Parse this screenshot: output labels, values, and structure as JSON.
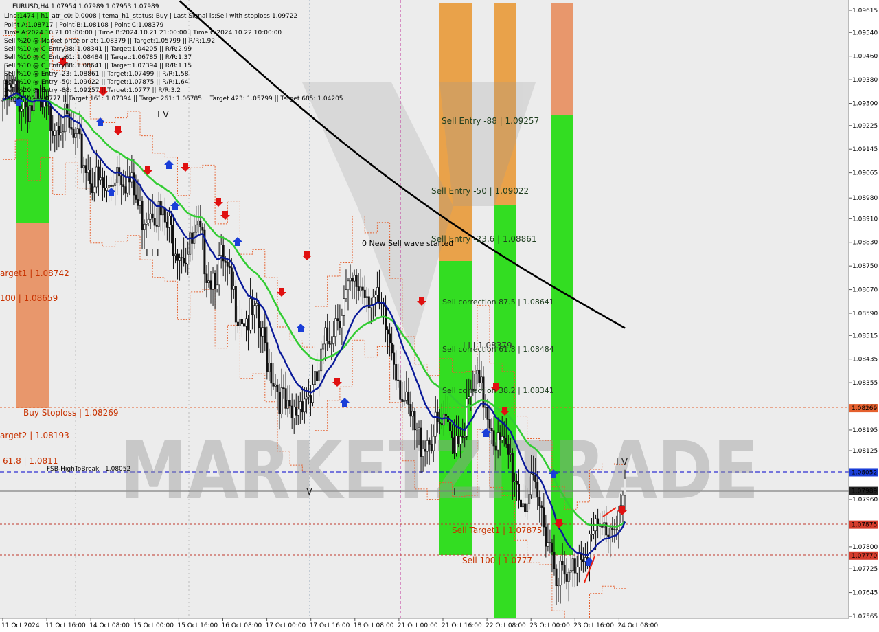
{
  "symbol_line": "EURUSD,H4  1.07954 1.07989 1.07953 1.07989",
  "info_lines": [
    "Line:1474  | h1_atr_c0: 0.0008  | tema_h1_status: Buy  | Last Signal is:Sell with stoploss:1.09722",
    "Point A:1.08717 | Point B:1.08108 | Point C:1.08379",
    "Time A:2024.10.21 01:00:00 | Time B:2024.10.21 21:00:00 | Time C:2024.10.22 10:00:00",
    "Sell %20 @ Market price or at: 1.08379  ||  Target:1.05799  ||  R/R:1.92",
    "Sell %10 @ C_Entry38: 1.08341  ||  Target:1.04205  ||  R/R:2.99",
    "Sell %10 @ C_Entry61: 1.08484  ||  Target:1.06785  ||  R/R:1.37",
    "Sell %10 @ C_Entry88: 1.08641  ||  Target:1.07394  ||  R/R:1.15",
    "Sell %10 @ Entry -23: 1.08861  ||  Target:1.07499  ||  R/R:1.58",
    "Sell %10 @ Entry -50: 1.09022  ||  Target:1.07875  ||  R/R:1.64",
    "Sell %20 @ Entry -88: 1.09257  ||  Target:1.0777  ||  R/R:3.2",
    "Target100: 1.0777  ||  Target 161: 1.07394  ||  Target 261: 1.06785  ||  Target 423: 1.05799  ||  Target 685: 1.04205"
  ],
  "watermark": "MARKETZITRADE",
  "zone_labels": [
    {
      "text": "Sell Entry -88 | 1.09257",
      "price": 1.09257,
      "color": "#1e3d1e"
    },
    {
      "text": "Sell Entry -50 | 1.09022",
      "price": 1.09022,
      "color": "#1e3d1e"
    },
    {
      "text": "Sell Entry -23.6 | 1.08861",
      "price": 1.08861,
      "color": "#1e3d1e"
    },
    {
      "text": "0 New Sell wave started",
      "price": 1.0883,
      "color": "#000000"
    },
    {
      "text": "Sell correction 87.5 | 1.08641",
      "price": 1.08641,
      "color": "#1e3d1e"
    },
    {
      "text": "Sell correction 61.8 | 1.08484",
      "price": 1.08484,
      "color": "#1e3d1e"
    },
    {
      "text": "Sell correction 38.2 | 1.08341",
      "price": 1.08341,
      "color": "#1e3d1e"
    },
    {
      "text": "Sell Target1 | 1.07875",
      "price": 1.07875,
      "color": "#c83200"
    },
    {
      "text": "Sell 100 | 1.0777",
      "price": 1.0777,
      "color": "#c83200"
    },
    {
      "text": "I  I  I  1.08379",
      "price": 1.08505,
      "color": "#333333"
    }
  ],
  "left_labels": [
    {
      "text": "arget1 | 1.08742",
      "price": 1.08742,
      "color": "#c83200"
    },
    {
      "text": "100 | 1.08659",
      "price": 1.08659,
      "color": "#c83200"
    },
    {
      "text": "Buy Stoploss | 1.08269",
      "price": 1.08269,
      "color": "#c83200"
    },
    {
      "text": "arget2 | 1.08193",
      "price": 1.08193,
      "color": "#c83200"
    },
    {
      "text": "61.8 | 1.0811",
      "price": 1.0811,
      "color": "#c83200"
    },
    {
      "text": "FSB-HighToBreak  |  1.08052",
      "price": 1.08052,
      "color": "#000000"
    }
  ],
  "marks": [
    "I V",
    "I I I",
    "I V",
    "I",
    "V",
    "I"
  ],
  "colors": {
    "green_zone": "#33dd22",
    "orange_zone": "#e9a24a",
    "salmon_zone": "#e8976c",
    "ema_green": "#33cc33",
    "ema_blue": "#0a1a99",
    "ma_black": "#000000",
    "stoploss": "#e5602e",
    "target": "#c0392b",
    "high_to_break": "#0000cc",
    "current": "#555555"
  },
  "chart_data": {
    "type": "candlestick",
    "symbol": "EURUSD",
    "timeframe": "H4",
    "ohlc_last": {
      "open": 1.07954,
      "high": 1.07989,
      "low": 1.07953,
      "close": 1.07989
    },
    "y_ticks": [
      1.09615,
      1.0954,
      1.0946,
      1.0938,
      1.093,
      1.09225,
      1.09145,
      1.09065,
      1.0898,
      1.0891,
      1.0883,
      1.0875,
      1.0867,
      1.0859,
      1.08515,
      1.08435,
      1.08355,
      1.08275,
      1.08195,
      1.08125,
      1.0796,
      1.078,
      1.07725,
      1.07645,
      1.07565
    ],
    "x_ticks": [
      "11 Oct 2024",
      "11 Oct 16:00",
      "14 Oct 08:00",
      "15 Oct 00:00",
      "15 Oct 16:00",
      "16 Oct 08:00",
      "17 Oct 00:00",
      "17 Oct 16:00",
      "18 Oct 08:00",
      "21 Oct 00:00",
      "21 Oct 16:00",
      "22 Oct 08:00",
      "23 Oct 00:00",
      "23 Oct 16:00",
      "24 Oct 08:00"
    ],
    "ylim": [
      1.0755,
      1.0965
    ],
    "price_badges": [
      {
        "value": "1.08269",
        "price": 1.08269,
        "color": "#e5602e"
      },
      {
        "value": "1.08052",
        "price": 1.08052,
        "color": "#1a3ed8"
      },
      {
        "value": "1.07989",
        "price": 1.07989,
        "color": "#222222"
      },
      {
        "value": "1.07875",
        "price": 1.07875,
        "color": "#d43c2c"
      },
      {
        "value": "1.07770",
        "price": 1.0777,
        "color": "#d43c2c"
      }
    ],
    "close_path": [
      1.0931,
      1.09335,
      1.093,
      1.0928,
      1.09245,
      1.09265,
      1.0918,
      1.0911,
      1.09035,
      1.0899,
      1.091,
      1.0903,
      1.0892,
      1.0897,
      1.0889,
      1.0884,
      1.0879,
      1.0885,
      1.0872,
      1.0876,
      1.0864,
      1.0858,
      1.0856,
      1.0844,
      1.0832,
      1.0821,
      1.0832,
      1.08315,
      1.0848,
      1.0859,
      1.0865,
      1.0869,
      1.0866,
      1.0856,
      1.0845,
      1.0826,
      1.0816,
      1.0817,
      1.082,
      1.0817,
      1.0821,
      1.0835,
      1.08285,
      1.0814,
      1.081,
      1.0796,
      1.0798,
      1.0789,
      1.0774,
      1.0766,
      1.0779,
      1.0782,
      1.0785,
      1.0788,
      1.0797
    ]
  }
}
